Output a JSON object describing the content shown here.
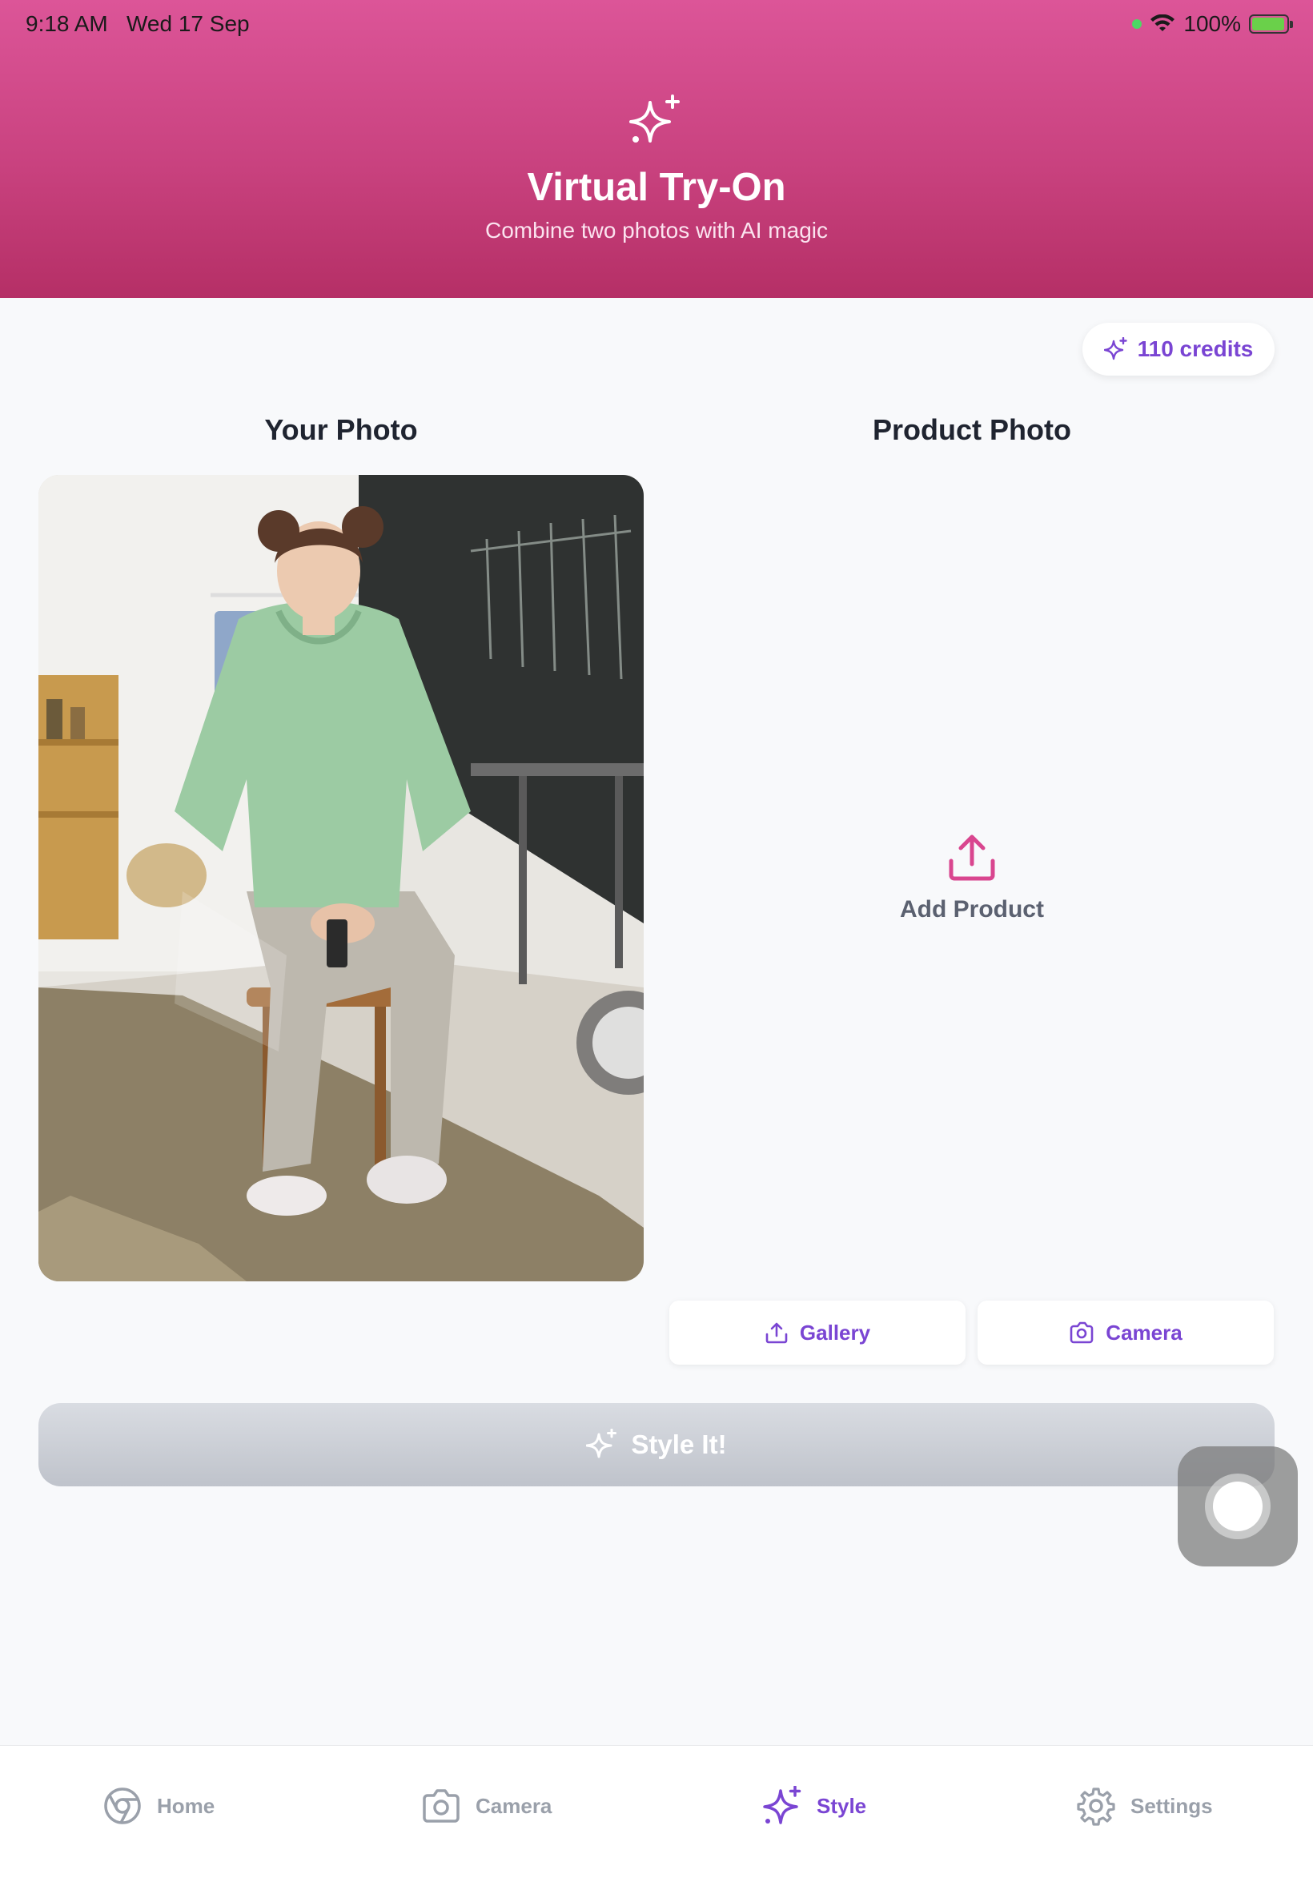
{
  "status_bar": {
    "time": "9:18 AM",
    "date": "Wed 17 Sep",
    "battery": "100%"
  },
  "header": {
    "icon": "sparkles-icon",
    "title": "Virtual Try-On",
    "subtitle": "Combine two photos with AI magic"
  },
  "credits": {
    "label": "110 credits",
    "icon": "sparkles-icon"
  },
  "your_photo": {
    "title": "Your Photo"
  },
  "product_photo": {
    "title": "Product Photo",
    "add_label": "Add Product",
    "icon": "upload-icon"
  },
  "buttons": {
    "gallery": "Gallery",
    "camera": "Camera",
    "style_it": "Style It!"
  },
  "tabs": [
    {
      "label": "Home",
      "icon": "home-icon",
      "active": false
    },
    {
      "label": "Camera",
      "icon": "camera-icon",
      "active": false
    },
    {
      "label": "Style",
      "icon": "sparkles-icon",
      "active": true
    },
    {
      "label": "Settings",
      "icon": "gear-icon",
      "active": false
    }
  ],
  "colors": {
    "header_gradient_top": "#dc5598",
    "header_gradient_bottom": "#b52f66",
    "accent": "#7a45d3",
    "upload_pink": "#d9468f",
    "disabled_button": "#c7cad1"
  }
}
